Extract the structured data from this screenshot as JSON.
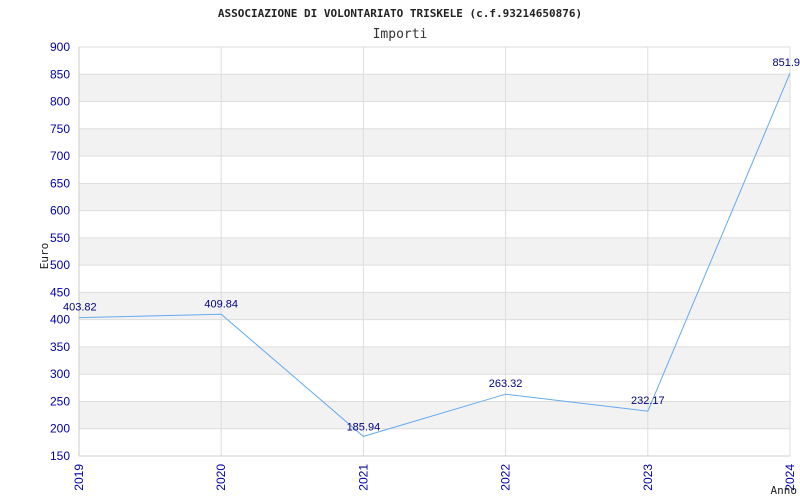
{
  "chart_data": {
    "type": "line",
    "title": "ASSOCIAZIONE DI VOLONTARIATO TRISKELE (c.f.93214650876)",
    "subtitle": "Importi",
    "xlabel": "Anno",
    "ylabel": "Euro",
    "x": [
      "2019",
      "2020",
      "2021",
      "2022",
      "2023",
      "2024"
    ],
    "series": [
      {
        "values": [
          403.82,
          409.84,
          185.94,
          263.32,
          232.17,
          851.9
        ],
        "labels": [
          "403.82",
          "409.84",
          "185.94",
          "263.32",
          "232.17",
          "851.9"
        ]
      }
    ],
    "ylim": [
      150,
      900
    ],
    "yticks": [
      900,
      850,
      800,
      750,
      700,
      650,
      600,
      550,
      500,
      450,
      400,
      350,
      300,
      250,
      200,
      150
    ],
    "grid": true,
    "legend": "none",
    "colors": {
      "line": "#66aaee",
      "tick_text": "#0000aa",
      "data_label": "#000080",
      "band": "#f2f2f2",
      "gridline": "#dddddd"
    }
  }
}
